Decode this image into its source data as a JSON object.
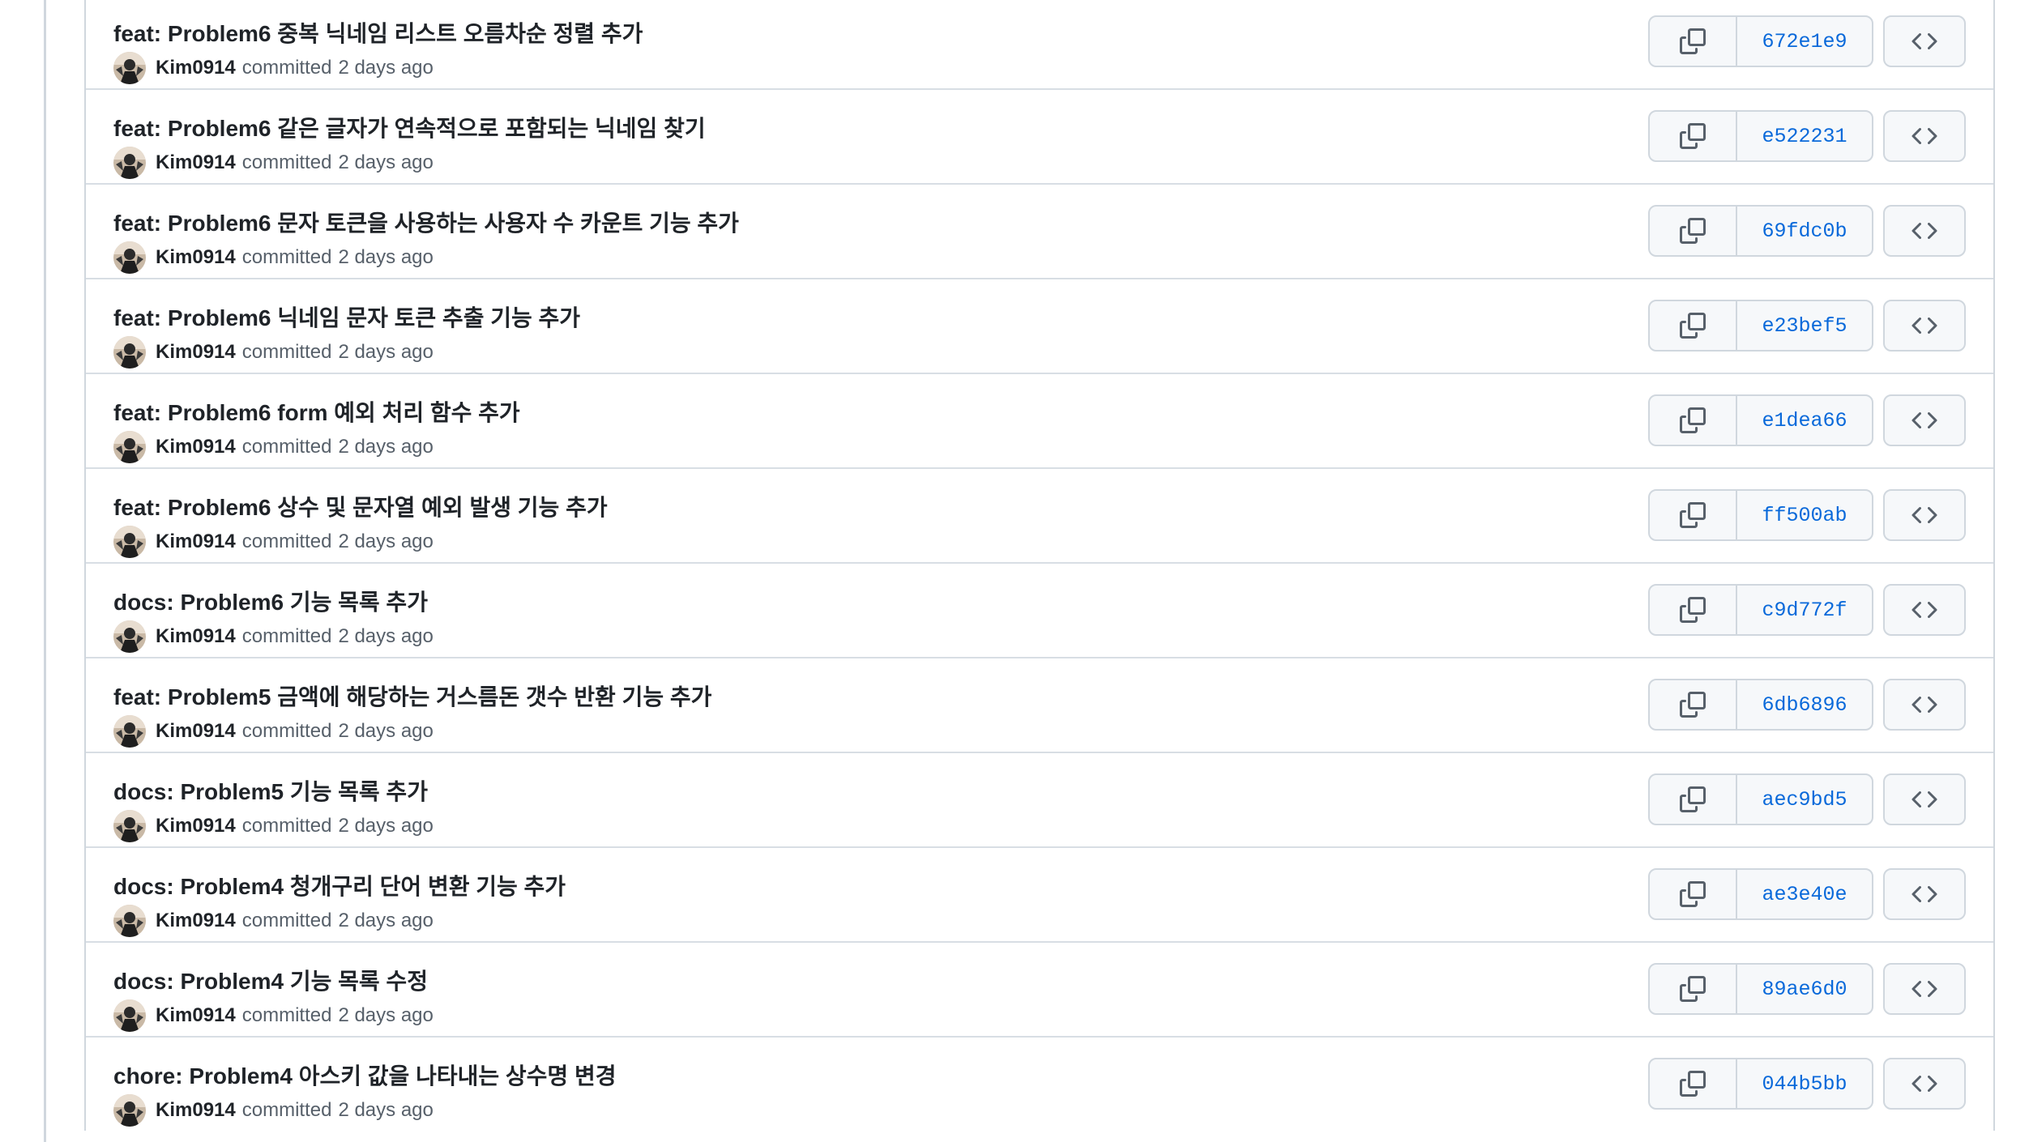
{
  "commits": [
    {
      "title": "feat: Problem6 중복 닉네임 리스트 오름차순 정렬 추가",
      "author": "Kim0914",
      "action": "committed",
      "time": "2 days ago",
      "sha": "672e1e9"
    },
    {
      "title": "feat: Problem6 같은 글자가 연속적으로 포함되는 닉네임 찾기",
      "author": "Kim0914",
      "action": "committed",
      "time": "2 days ago",
      "sha": "e522231"
    },
    {
      "title": "feat: Problem6 문자 토큰을 사용하는 사용자 수 카운트 기능 추가",
      "author": "Kim0914",
      "action": "committed",
      "time": "2 days ago",
      "sha": "69fdc0b"
    },
    {
      "title": "feat: Problem6 닉네임 문자 토큰 추출 기능 추가",
      "author": "Kim0914",
      "action": "committed",
      "time": "2 days ago",
      "sha": "e23bef5"
    },
    {
      "title": "feat: Problem6 form 예외 처리 함수 추가",
      "author": "Kim0914",
      "action": "committed",
      "time": "2 days ago",
      "sha": "e1dea66"
    },
    {
      "title": "feat: Problem6 상수 및 문자열 예외 발생 기능 추가",
      "author": "Kim0914",
      "action": "committed",
      "time": "2 days ago",
      "sha": "ff500ab"
    },
    {
      "title": "docs: Problem6 기능 목록 추가",
      "author": "Kim0914",
      "action": "committed",
      "time": "2 days ago",
      "sha": "c9d772f"
    },
    {
      "title": "feat: Problem5 금액에 해당하는 거스름돈 갯수 반환 기능 추가",
      "author": "Kim0914",
      "action": "committed",
      "time": "2 days ago",
      "sha": "6db6896"
    },
    {
      "title": "docs: Problem5 기능 목록 추가",
      "author": "Kim0914",
      "action": "committed",
      "time": "2 days ago",
      "sha": "aec9bd5"
    },
    {
      "title": "docs: Problem4 청개구리 단어 변환 기능 추가",
      "author": "Kim0914",
      "action": "committed",
      "time": "2 days ago",
      "sha": "ae3e40e"
    },
    {
      "title": "docs: Problem4 기능 목록 수정",
      "author": "Kim0914",
      "action": "committed",
      "time": "2 days ago",
      "sha": "89ae6d0"
    },
    {
      "title": "chore: Problem4 아스키 값을 나타내는 상수명 변경",
      "author": "Kim0914",
      "action": "committed",
      "time": "2 days ago",
      "sha": "044b5bb"
    }
  ],
  "icons": {
    "avatar": "avatar-photo",
    "copy": "copy-icon",
    "browse": "code-icon"
  },
  "colors": {
    "sha_link": "#0969da",
    "border": "#d0d7de",
    "button_bg": "#f6f8fa"
  }
}
